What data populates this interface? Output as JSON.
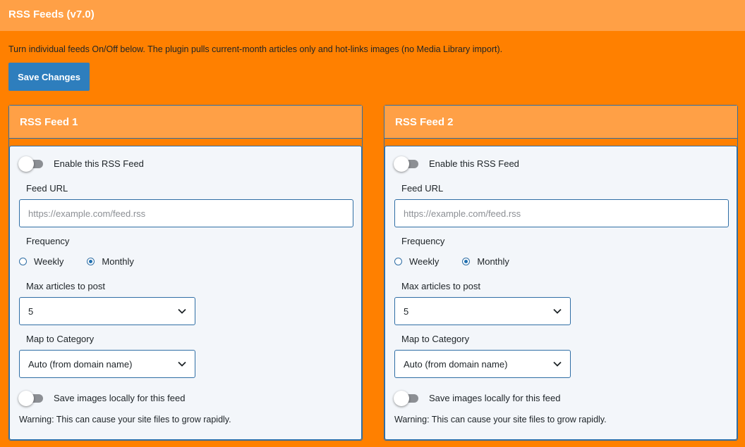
{
  "page": {
    "title": "RSS Feeds (v7.0)",
    "intro": "Turn individual feeds On/Off below. The plugin pulls current-month articles only and hot-links images (no Media Library import).",
    "save_label": "Save Changes"
  },
  "feeds": [
    {
      "title": "RSS Feed 1",
      "enable_label": "Enable this RSS Feed",
      "enabled": false,
      "url_label": "Feed URL",
      "url_value": "",
      "url_placeholder": "https://example.com/feed.rss",
      "frequency_label": "Frequency",
      "frequency_options": [
        "Weekly",
        "Monthly"
      ],
      "frequency_selected": "Monthly",
      "max_label": "Max articles to post",
      "max_value": "5",
      "category_label": "Map to Category",
      "category_value": "Auto (from domain name)",
      "save_images_label": "Save images locally for this feed",
      "save_images": false,
      "warning": "Warning: This can cause your site files to grow rapidly."
    },
    {
      "title": "RSS Feed 2",
      "enable_label": "Enable this RSS Feed",
      "enabled": false,
      "url_label": "Feed URL",
      "url_value": "",
      "url_placeholder": "https://example.com/feed.rss",
      "frequency_label": "Frequency",
      "frequency_options": [
        "Weekly",
        "Monthly"
      ],
      "frequency_selected": "Monthly",
      "max_label": "Max articles to post",
      "max_value": "5",
      "category_label": "Map to Category",
      "category_value": "Auto (from domain name)",
      "save_images_label": "Save images locally for this feed",
      "save_images": false,
      "warning": "Warning: This can cause your site files to grow rapidly."
    }
  ],
  "colors": {
    "page_bg": "#ff8000",
    "header_bg": "#ffa046",
    "button_bg": "#2e7ebd",
    "border": "#2f6ea5",
    "panel_body_bg": "#f3f6fa",
    "toggle_off": "#8c8f94",
    "radio_checked": "#2271b1"
  },
  "icons": {
    "select_arrow": "chevron-down-icon",
    "toggle": "toggle-switch-off"
  }
}
